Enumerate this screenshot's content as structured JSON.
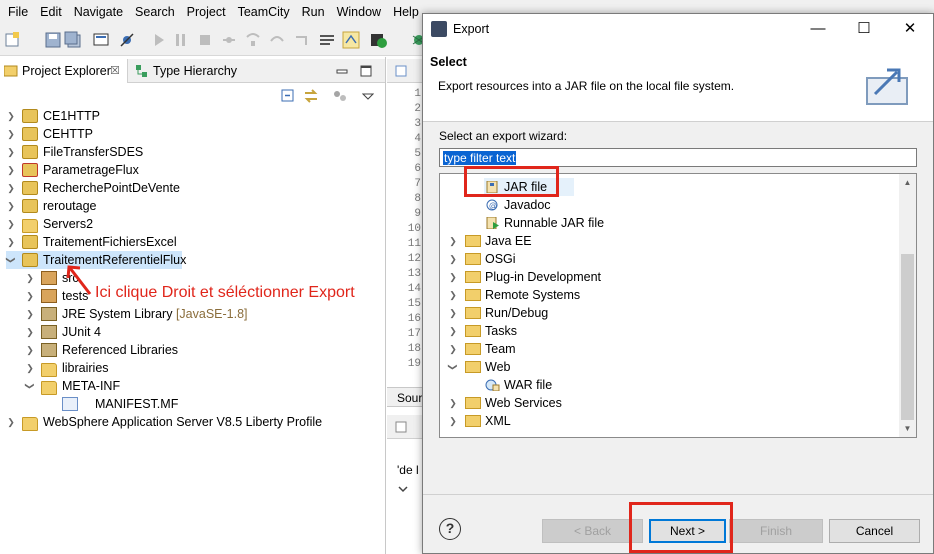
{
  "menu": [
    "File",
    "Edit",
    "Navigate",
    "Search",
    "Project",
    "TeamCity",
    "Run",
    "Window",
    "Help"
  ],
  "project_explorer": {
    "tab_label": "Project Explorer",
    "tab2_label": "Type Hierarchy",
    "close_glyph": "☒",
    "items": [
      {
        "label": "CE1HTTP",
        "icon": "project-icon"
      },
      {
        "label": "CEHTTP",
        "icon": "project-icon"
      },
      {
        "label": "FileTransferSDES",
        "icon": "project-icon"
      },
      {
        "label": "ParametrageFlux",
        "icon": "project-icon"
      },
      {
        "label": "RecherchePointDeVente",
        "icon": "project-icon"
      },
      {
        "label": "reroutage",
        "icon": "project-icon"
      },
      {
        "label": "Servers2",
        "icon": "folder-icon"
      },
      {
        "label": "TraitementFichiersExcel",
        "icon": "project-icon"
      },
      {
        "label": "TraitementReferentielFlux",
        "icon": "project-icon"
      },
      {
        "label": "src",
        "icon": "package-icon"
      },
      {
        "label": "tests",
        "icon": "package-icon"
      },
      {
        "label": "JRE System Library",
        "decoration": "[JavaSE-1.8]",
        "icon": "library-icon"
      },
      {
        "label": "JUnit 4",
        "icon": "library-icon"
      },
      {
        "label": "Referenced Libraries",
        "icon": "library-icon"
      },
      {
        "label": "librairies",
        "icon": "folder-icon"
      },
      {
        "label": "META-INF",
        "icon": "folder-icon"
      },
      {
        "label": "MANIFEST.MF",
        "icon": "manifest-file-icon"
      },
      {
        "label": "WebSphere Application Server V8.5 Liberty Profile",
        "icon": "server-project-icon"
      }
    ]
  },
  "annotation": "Ici clique Droit et séléctionner Export",
  "editor": {
    "line_numbers": [
      "1",
      "2",
      "3",
      "4",
      "5",
      "6",
      "7",
      "8",
      "9",
      "10",
      "11",
      "12",
      "13",
      "14",
      "15",
      "16",
      "17",
      "18",
      "19"
    ],
    "source_tab": "Sour",
    "lower_text": "'de l"
  },
  "dialog": {
    "title": "Export",
    "header_title": "Select",
    "header_desc": "Export resources into a JAR file on the local file system.",
    "wizard_label": "Select an export wizard:",
    "filter_text": "type filter text",
    "tree": [
      {
        "label": "JAR file",
        "icon": "jar-icon"
      },
      {
        "label": "Javadoc",
        "icon": "javadoc-icon"
      },
      {
        "label": "Runnable JAR file",
        "icon": "runnable-jar-icon"
      },
      {
        "label": "Java EE",
        "icon": "folder-icon"
      },
      {
        "label": "OSGi",
        "icon": "folder-icon"
      },
      {
        "label": "Plug-in Development",
        "icon": "folder-icon"
      },
      {
        "label": "Remote Systems",
        "icon": "folder-icon"
      },
      {
        "label": "Run/Debug",
        "icon": "folder-icon"
      },
      {
        "label": "Tasks",
        "icon": "folder-icon"
      },
      {
        "label": "Team",
        "icon": "folder-icon"
      },
      {
        "label": "Web",
        "icon": "folder-icon"
      },
      {
        "label": "WAR file",
        "icon": "war-icon"
      },
      {
        "label": "Web Services",
        "icon": "folder-icon"
      },
      {
        "label": "XML",
        "icon": "folder-icon"
      }
    ],
    "buttons": {
      "back": "< Back",
      "next": "Next >",
      "finish": "Finish",
      "cancel": "Cancel"
    },
    "help_glyph": "?",
    "window_buttons": {
      "minimize": "—",
      "maximize": "☐",
      "close": "✕"
    }
  },
  "colors": {
    "annotation_red": "#e0261b",
    "selection_blue": "#0a64d2",
    "dialog_bg": "#f0f0f0"
  }
}
